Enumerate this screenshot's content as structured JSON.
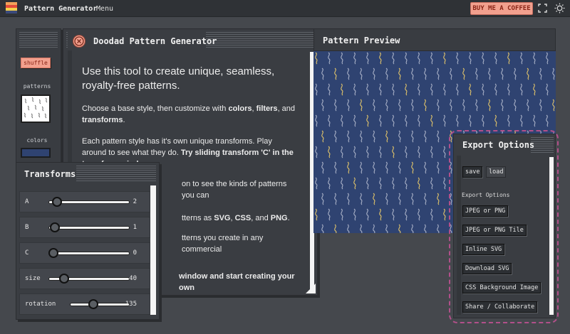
{
  "topbar": {
    "app_title": "Pattern Generator",
    "menu_label": "Menu",
    "coffee_label": "BUY ME A COFFEE",
    "logo_colors": [
      "#f2a25a",
      "#e44b3a",
      "#f4d04b",
      "#3b4a7a"
    ],
    "fullscreen_icon": "fullscreen-icon",
    "theme_icon": "sun-icon"
  },
  "tools": {
    "shuffle_label": "shuffle",
    "patterns_label": "patterns",
    "colors_label": "colors",
    "current_color": "#2f4371"
  },
  "info": {
    "title": "Doodad Pattern Generator",
    "close_icon": "close-icon",
    "lead": "Use this tool to create unique, seamless, royalty-free patterns.",
    "p1_pre": "Choose a base style, then customize with ",
    "p1_colors": "colors",
    "p1_mid1": ", ",
    "p1_filters": "filters",
    "p1_mid2": ", and ",
    "p1_transforms": "transforms",
    "p1_end": ".",
    "p2_pre": "Each pattern style has it's own unique transforms. Play around to see what they do. ",
    "p2_bold": "Try sliding transform 'C' in the transform window",
    "p3": "on to see the kinds of patterns you can",
    "p4_pre": "tterns as ",
    "p4_svg": "SVG",
    "p4_sep1": ", ",
    "p4_css": "CSS",
    "p4_sep2": ", and ",
    "p4_png": "PNG",
    "p4_end": ".",
    "p5": "tterns you create in any commercial",
    "p6_bold": "window and start creating your own"
  },
  "preview": {
    "title": "Pattern Preview",
    "bg_color": "#2f4371",
    "squiggle_colors": [
      "#aab2c8",
      "#e3c56a"
    ]
  },
  "transforms": {
    "title": "Transforms",
    "rows": [
      {
        "label": "A",
        "value": "2",
        "level": 0.05
      },
      {
        "label": "B",
        "value": "1",
        "level": 0.02
      },
      {
        "label": "C",
        "value": "0",
        "level": 0.0
      },
      {
        "label": "size",
        "value": "40",
        "level": 0.15
      },
      {
        "label": "rotation",
        "value": "135",
        "level": 0.37
      }
    ]
  },
  "export": {
    "title": "Export Options",
    "save_label": "save",
    "load_label": "load",
    "section_label": "Export Options",
    "buttons": [
      "JPEG or PNG",
      "JPEG or PNG Tile",
      "Inline SVG",
      "Download SVG",
      "CSS Background Image",
      "Share / Collaborate"
    ]
  }
}
